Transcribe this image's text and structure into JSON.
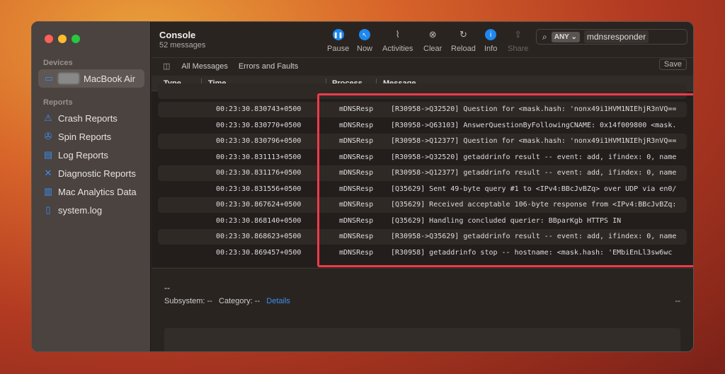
{
  "sidebar": {
    "devices_label": "Devices",
    "device": "MacBook Air",
    "reports_label": "Reports",
    "items": [
      {
        "label": "Crash Reports",
        "icon": "warning-icon"
      },
      {
        "label": "Spin Reports",
        "icon": "spin-icon"
      },
      {
        "label": "Log Reports",
        "icon": "document-icon"
      },
      {
        "label": "Diagnostic Reports",
        "icon": "tools-icon"
      },
      {
        "label": "Mac Analytics Data",
        "icon": "chart-icon"
      },
      {
        "label": "system.log",
        "icon": "file-icon"
      }
    ]
  },
  "header": {
    "title": "Console",
    "subtitle": "52 messages"
  },
  "toolbar": {
    "pause": "Pause",
    "now": "Now",
    "activities": "Activities",
    "clear": "Clear",
    "reload": "Reload",
    "info": "Info",
    "share": "Share"
  },
  "search": {
    "scope": "ANY",
    "value": "mdnsresponder"
  },
  "filters": {
    "all": "All Messages",
    "errors": "Errors and Faults",
    "save": "Save"
  },
  "columns": {
    "type": "Type",
    "time": "Time",
    "process": "Process",
    "message": "Message"
  },
  "rows": [
    {
      "time": "00:23:30.830743+0500",
      "process": "mDNSResp",
      "message": "[R30958->Q32520] Question for <mask.hash: 'nonx49i1HVM1NIEhjR3nVQ=="
    },
    {
      "time": "00:23:30.830770+0500",
      "process": "mDNSResp",
      "message": "[R30958->Q63103] AnswerQuestionByFollowingCNAME: 0x14f009800 <mask."
    },
    {
      "time": "00:23:30.830796+0500",
      "process": "mDNSResp",
      "message": "[R30958->Q12377] Question for <mask.hash: 'nonx49i1HVM1NIEhjR3nVQ=="
    },
    {
      "time": "00:23:30.831113+0500",
      "process": "mDNSResp",
      "message": "[R30958->Q32520] getaddrinfo result -- event: add, ifindex: 0, name"
    },
    {
      "time": "00:23:30.831176+0500",
      "process": "mDNSResp",
      "message": "[R30958->Q12377] getaddrinfo result -- event: add, ifindex: 0, name"
    },
    {
      "time": "00:23:30.831556+0500",
      "process": "mDNSResp",
      "message": "[Q35629] Sent 49-byte query #1 to <IPv4:BBcJvBZq> over UDP via en0/"
    },
    {
      "time": "00:23:30.867624+0500",
      "process": "mDNSResp",
      "message": "[Q35629] Received acceptable 106-byte response from <IPv4:BBcJvBZq:"
    },
    {
      "time": "00:23:30.868140+0500",
      "process": "mDNSResp",
      "message": "[Q35629] Handling concluded querier: BBparKgb HTTPS IN"
    },
    {
      "time": "00:23:30.868623+0500",
      "process": "mDNSResp",
      "message": "[R30958->Q35629] getaddrinfo result -- event: add, ifindex: 0, name"
    },
    {
      "time": "00:23:30.869457+0500",
      "process": "mDNSResp",
      "message": "[R30958] getaddrinfo stop -- hostname: <mask.hash: 'EMbiEnLl3sw6wc"
    }
  ],
  "detail": {
    "title": "--",
    "subsystem": "Subsystem: --",
    "category": "Category: --",
    "details": "Details",
    "dash": "--"
  },
  "colors": {
    "accent": "#1e88f0",
    "highlight": "#f03a48"
  }
}
